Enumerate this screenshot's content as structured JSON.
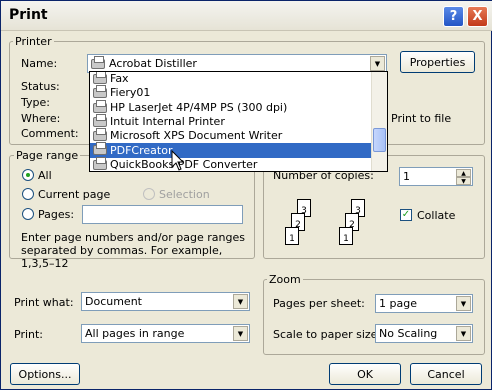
{
  "title": "Print",
  "help_glyph": "?",
  "close_glyph": "X",
  "printer": {
    "legend": "Printer",
    "name_label": "Name:",
    "name_value": "Acrobat Distiller",
    "properties_label": "Properties",
    "status_label": "Status:",
    "type_label": "Type:",
    "where_label": "Where:",
    "comment_label": "Comment:",
    "print_to_file_label": "Print to file",
    "dropdown_items": [
      "Fax",
      "Fiery01",
      "HP LaserJet 4P/4MP PS (300 dpi)",
      "Intuit Internal Printer",
      "Microsoft XPS Document Writer",
      "PDFCreator",
      "QuickBooks PDF Converter"
    ],
    "selected_index": 5
  },
  "page_range": {
    "legend": "Page range",
    "all_label": "All",
    "current_page_label": "Current page",
    "selection_label": "Selection",
    "pages_label": "Pages:",
    "pages_value": "",
    "hint": "Enter page numbers and/or page ranges separated by commas.  For example, 1,3,5–12"
  },
  "copies": {
    "number_label": "Number of copies:",
    "number_value": "1",
    "collate_label": "Collate",
    "collate_checked": true,
    "page_numbers": [
      "3",
      "2",
      "1",
      "3",
      "2",
      "1"
    ]
  },
  "print_what": {
    "label": "Print what:",
    "value": "Document"
  },
  "print": {
    "label": "Print:",
    "value": "All pages in range"
  },
  "zoom": {
    "legend": "Zoom",
    "pages_per_sheet_label": "Pages per sheet:",
    "pages_per_sheet_value": "1 page",
    "scale_label": "Scale to paper size:",
    "scale_value": "No Scaling"
  },
  "buttons": {
    "options": "Options...",
    "ok": "OK",
    "cancel": "Cancel"
  }
}
